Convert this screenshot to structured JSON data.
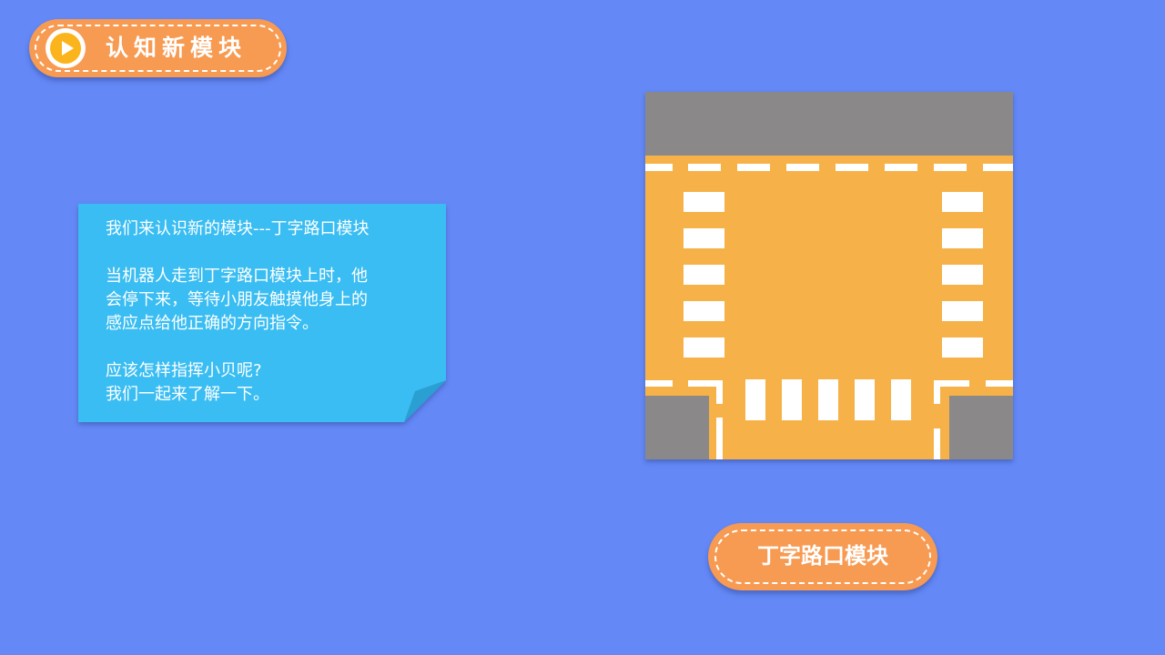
{
  "header": {
    "title": "认知新模块",
    "icon": "play-icon"
  },
  "note": {
    "paragraph_1": "我们来认识新的模块---丁字路口模块",
    "paragraph_2": "当机器人走到丁字路口模块上时，他\n会停下来，等待小朋友触摸他身上的\n感应点给他正确的方向指令。",
    "paragraph_3": "应该怎样指挥小贝呢?\n我们一起来了解一下。"
  },
  "caption": {
    "label": "丁字路口模块"
  },
  "colors": {
    "background": "#6489f7",
    "accent_orange": "#f79a52",
    "note_blue": "#3abdf2",
    "road_orange": "#f6b249",
    "gray": "#8a8888",
    "play_yellow": "#fbb41c"
  }
}
